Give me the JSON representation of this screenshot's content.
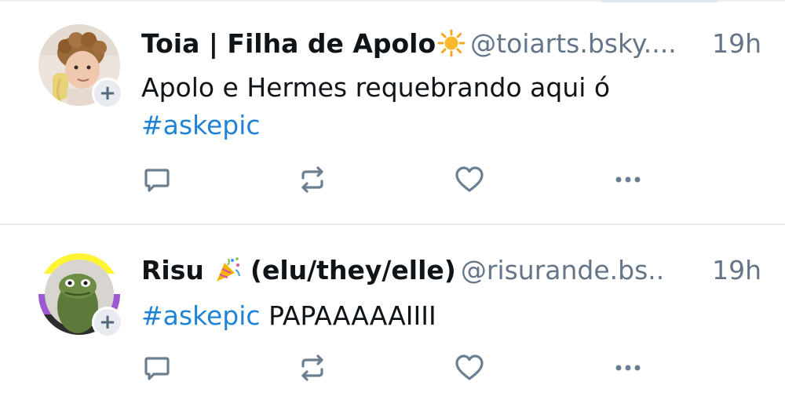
{
  "posts": [
    {
      "author_name": "Toia | Filha de Apolo",
      "author_emoji": "sun-emoji",
      "handle": "@toiarts.bsky....",
      "time": "19h",
      "text_plain": "Apolo e Hermes requebrando aqui ó",
      "hashtag": "#askepic",
      "follow_symbol": "+",
      "actions": [
        "reply-icon",
        "repost-icon",
        "like-icon",
        "more-icon"
      ]
    },
    {
      "author_name": "Risu",
      "author_emoji": "party-popper-emoji",
      "author_pronouns": "(elu/they/elle)",
      "handle": "@risurande.bs..",
      "time": "19h",
      "hashtag": "#askepic",
      "text_plain": "PAPAAAAAIIII",
      "follow_symbol": "+",
      "actions": [
        "reply-icon",
        "repost-icon",
        "like-icon",
        "more-icon"
      ]
    }
  ],
  "colors": {
    "text": "#0f1419",
    "muted": "#637587",
    "hashtag": "#1e83d6",
    "icon": "#6b7f92",
    "divider": "#e6e8eb"
  }
}
